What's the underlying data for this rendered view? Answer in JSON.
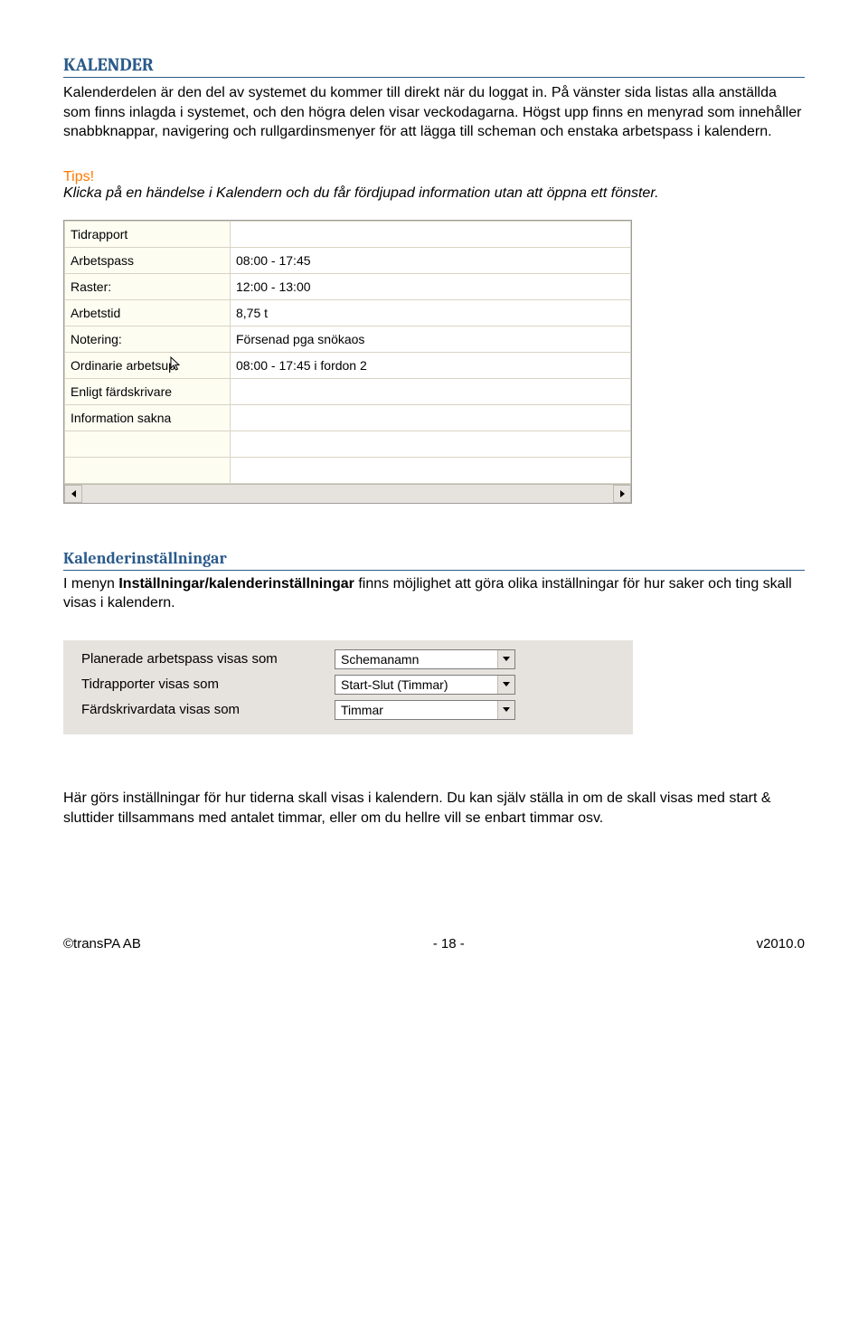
{
  "heading1": "KALENDER",
  "para1": "Kalenderdelen är den del av systemet du kommer till direkt när du loggat in. På vänster sida listas alla anställda som finns inlagda i systemet, och den högra delen visar veckodagarna. Högst upp finns en menyrad som innehåller snabbknappar, navigering och rullgardinsmenyer för att lägga till scheman och enstaka arbetspass i kalendern.",
  "tips_label": "Tips!",
  "tips_text": "Klicka på en händelse i Kalendern och du får fördjupad information utan att öppna ett fönster.",
  "table": [
    {
      "label": "Tidrapport",
      "value": ""
    },
    {
      "label": "Arbetspass",
      "value": "08:00 - 17:45"
    },
    {
      "label": "Raster:",
      "value": "12:00 - 13:00"
    },
    {
      "label": "Arbetstid",
      "value": "8,75 t"
    },
    {
      "label": "Notering:",
      "value": "Försenad pga snökaos"
    },
    {
      "label": "Ordinarie arbetsup",
      "value": "08:00 - 17:45 i fordon 2"
    },
    {
      "label": "Enligt färdskrivare",
      "value": ""
    },
    {
      "label": "Information sakna",
      "value": ""
    },
    {
      "label": "",
      "value": ""
    },
    {
      "label": "",
      "value": ""
    }
  ],
  "heading2": "Kalenderinställningar",
  "para2_a": "I menyn ",
  "para2_b": "Inställningar/kalenderinställningar",
  "para2_c": " finns möjlighet att göra olika inställningar för hur saker och ting skall visas i kalendern.",
  "settings": [
    {
      "label": "Planerade arbetspass visas som",
      "value": "Schemanamn"
    },
    {
      "label": "Tidrapporter visas som",
      "value": "Start-Slut (Timmar)"
    },
    {
      "label": "Färdskrivardata visas som",
      "value": "Timmar"
    }
  ],
  "para3": "Här görs inställningar för hur tiderna skall visas i kalendern. Du kan själv ställa in om de skall visas med start & sluttider tillsammans med antalet timmar, eller om du hellre vill se enbart timmar osv.",
  "footer": {
    "left": "©transPA AB",
    "center": "- 18 -",
    "right": "v2010.0"
  }
}
